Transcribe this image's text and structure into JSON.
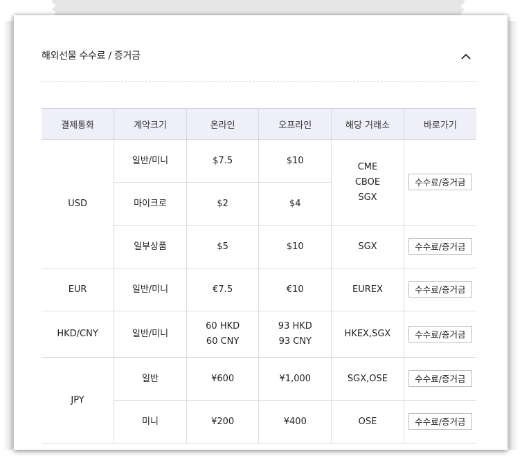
{
  "section": {
    "title": "해외선물 수수료 / 증거금"
  },
  "table": {
    "headers": [
      "결제통화",
      "계약크기",
      "온라인",
      "오프라인",
      "해당 거래소",
      "바로가기"
    ],
    "link_label": "수수료/증거금",
    "rows": {
      "usd": {
        "currency": "USD",
        "exchange_lines": [
          "CME",
          "CBOE",
          "SGX"
        ],
        "sub": [
          {
            "size": "일반/미니",
            "online": "$7.5",
            "offline": "$10"
          },
          {
            "size": "마이크로",
            "online": "$2",
            "offline": "$4"
          },
          {
            "size": "일부상품",
            "online": "$5",
            "offline": "$10",
            "exchange": "SGX"
          }
        ]
      },
      "eur": {
        "currency": "EUR",
        "size": "일반/미니",
        "online": "€7.5",
        "offline": "€10",
        "exchange": "EUREX"
      },
      "hkd": {
        "currency": "HKD/CNY",
        "size": "일반/미니",
        "online_lines": [
          "60 HKD",
          "60 CNY"
        ],
        "offline_lines": [
          "93 HKD",
          "93 CNY"
        ],
        "exchange": "HKEX,SGX"
      },
      "jpy": {
        "currency": "JPY",
        "sub": [
          {
            "size": "일반",
            "online": "¥600",
            "offline": "¥1,000",
            "exchange": "SGX,OSE"
          },
          {
            "size": "미니",
            "online": "¥200",
            "offline": "¥400",
            "exchange": "OSE"
          }
        ]
      }
    }
  },
  "icons": {
    "collapse": "chevron-up-icon"
  }
}
